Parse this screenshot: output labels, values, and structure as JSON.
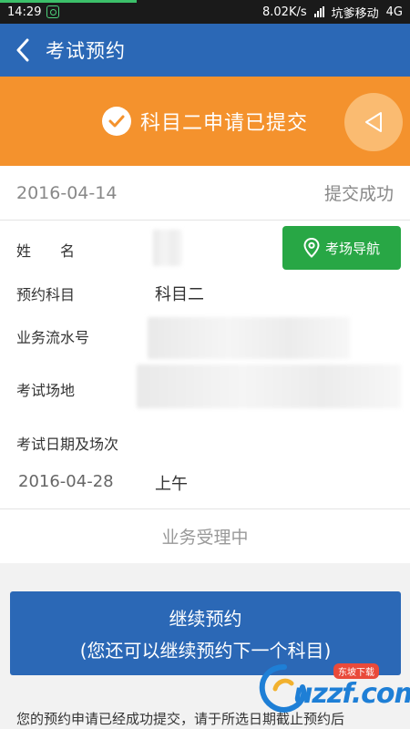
{
  "statusbar": {
    "time": "14:29",
    "speed": "8.02K/s",
    "carrier": "坑爹移动",
    "network": "4G"
  },
  "header": {
    "title": "考试预约"
  },
  "banner": {
    "text": "科目二申请已提交"
  },
  "submission": {
    "date": "2016-04-14",
    "status": "提交成功"
  },
  "info": {
    "name_label": "姓　　名",
    "subject_label": "预约科目",
    "subject_value": "科目二",
    "serial_label": "业务流水号",
    "venue_label": "考试场地",
    "exam_label": "考试日期及场次",
    "exam_date": "2016-04-28",
    "exam_session": "上午"
  },
  "nav_button": {
    "label": "考场导航"
  },
  "process_status": "业务受理中",
  "continue_button": {
    "line1": "继续预约",
    "line2": "(您还可以继续预约下一个科目)"
  },
  "notice": "您的预约申请已经成功提交，请于所选日期截止预约后",
  "watermark": {
    "text": "uzzf.com",
    "badge": "东坡下载"
  },
  "colors": {
    "primary": "#2b68b6",
    "banner": "#f4922d",
    "nav_button": "#28a745"
  }
}
